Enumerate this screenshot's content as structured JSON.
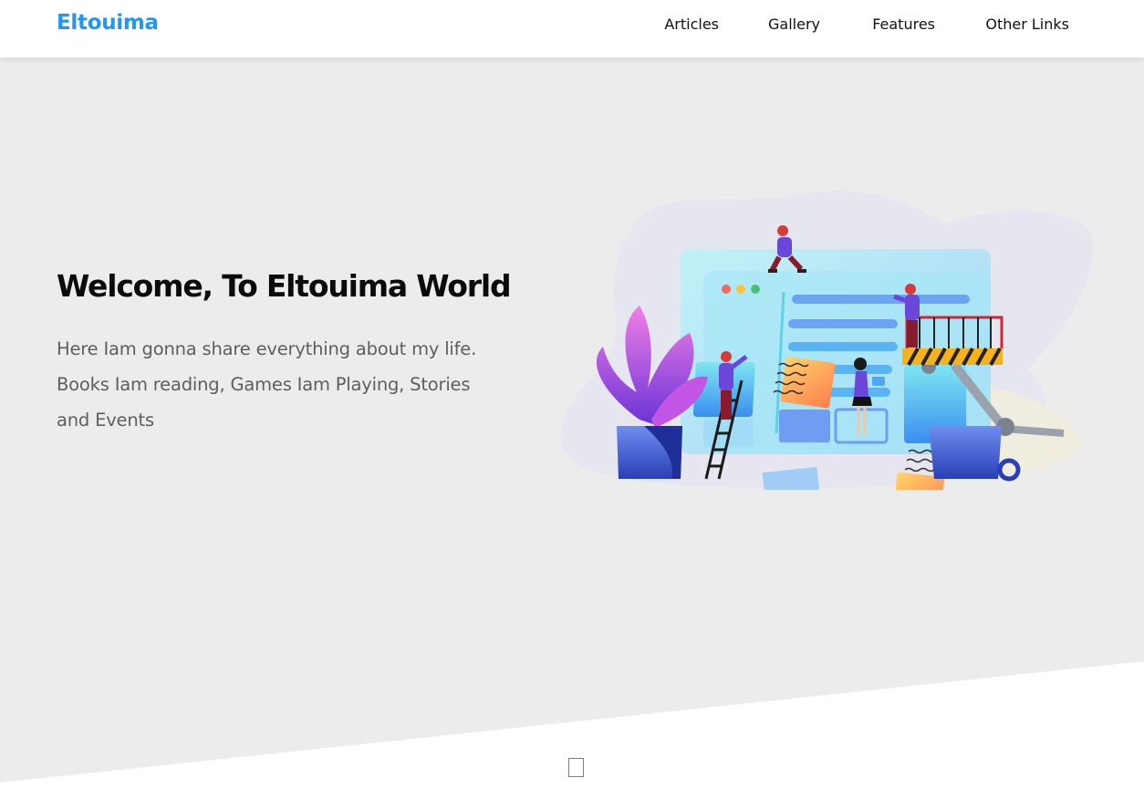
{
  "header": {
    "logo": "Eltouima",
    "nav": [
      "Articles",
      "Gallery",
      "Features",
      "Other Links"
    ]
  },
  "landing": {
    "title": "Welcome, To Eltouima World",
    "description": "Here Iam gonna share everything about my life. Books Iam reading, Games Iam Playing, Stories and Events",
    "illustration": "website-builders-illustration"
  },
  "go_down_icon": "square-outline-icon",
  "colors": {
    "brand": "#2196f3",
    "landing_background": "#ececed",
    "title": "#0b0b0b",
    "text": "#5e5e5e"
  }
}
